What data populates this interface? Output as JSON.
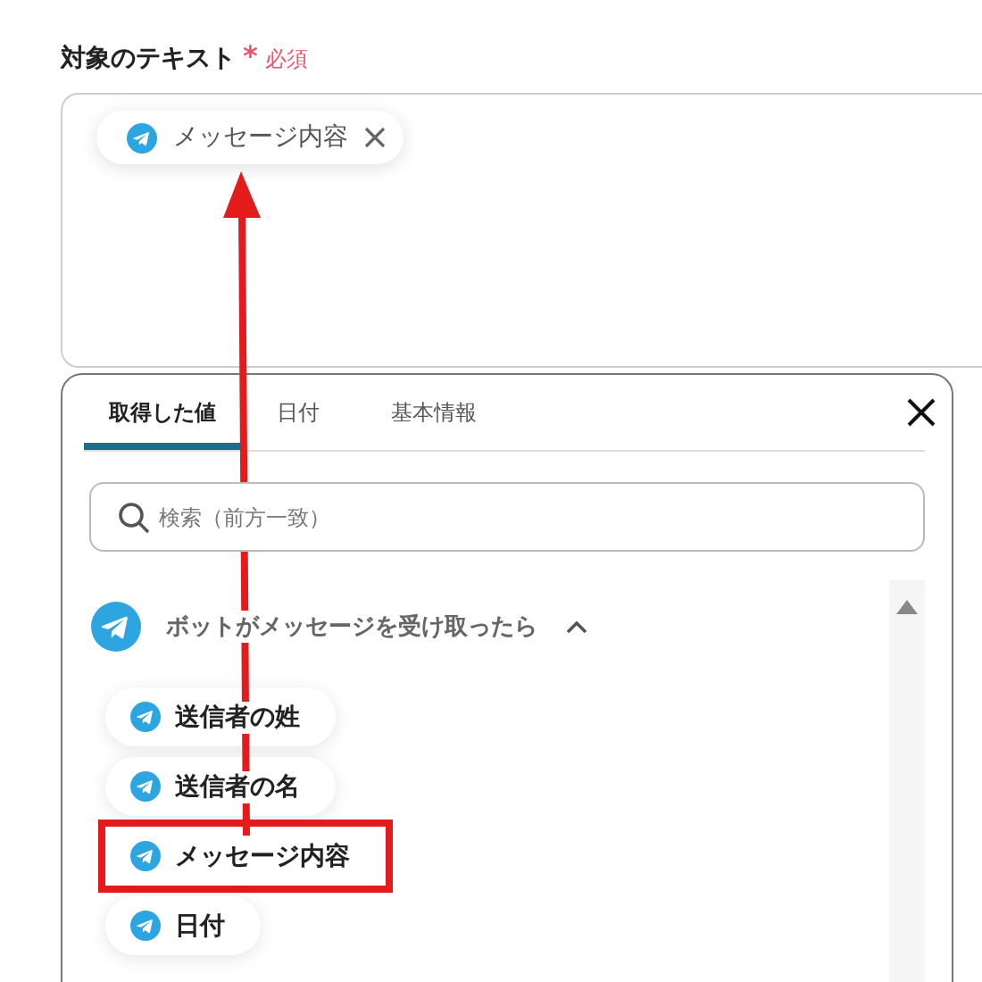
{
  "field": {
    "label": "対象のテキスト",
    "required_mark": "*",
    "required_text": "必須",
    "tokens": [
      {
        "label": "メッセージ内容"
      }
    ]
  },
  "panel": {
    "tabs": [
      {
        "label": "取得した値",
        "selected": true
      },
      {
        "label": "日付",
        "selected": false
      },
      {
        "label": "基本情報",
        "selected": false
      }
    ],
    "search": {
      "placeholder": "検索（前方一致）"
    },
    "groups": [
      {
        "title": "ボットがメッセージを受け取ったら",
        "expanded": true,
        "items": [
          {
            "label": "送信者の姓",
            "highlighted": false
          },
          {
            "label": "送信者の名",
            "highlighted": false
          },
          {
            "label": "メッセージ内容",
            "highlighted": true
          },
          {
            "label": "日付",
            "highlighted": false
          }
        ]
      }
    ]
  }
}
